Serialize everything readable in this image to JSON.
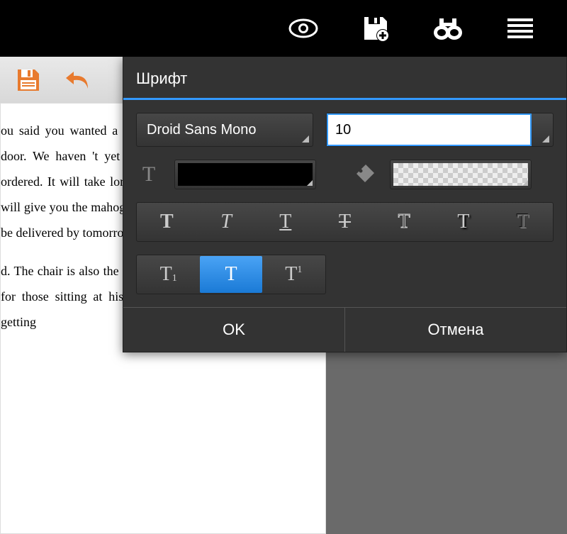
{
  "dialog": {
    "title": "Шрифт",
    "font_family": "Droid Sans Mono",
    "font_size": "10",
    "ok_label": "OK",
    "cancel_label": "Отмена"
  },
  "document": {
    "p1": "ou said you wanted a chair , mahogany desk , and sliding door. We haven 't yet received materials of the chair you ordered. It will take longer than the day after tomorrow. We will give you the mahogany desk and sliding door, which will be delivered by tomorrow with a very pleasant color.",
    "p2": "d. The chair is also the latest product of finomically designed for those sitting at his them to stretch their body without getting"
  }
}
